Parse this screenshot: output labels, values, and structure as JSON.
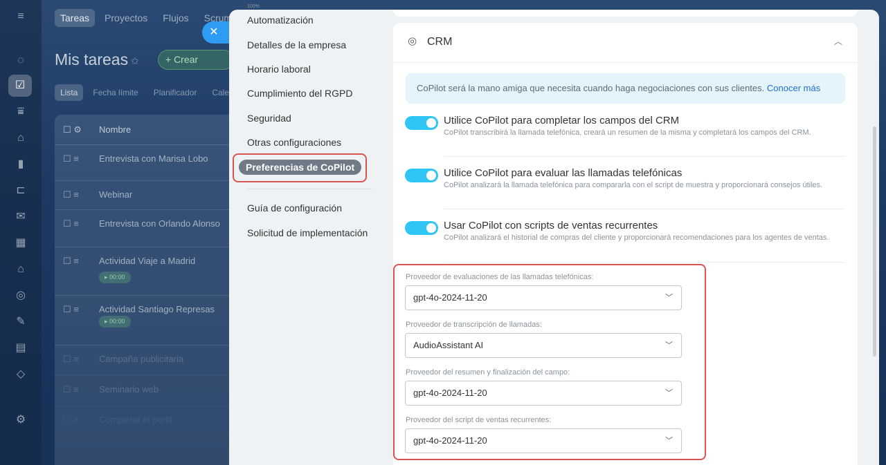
{
  "background_app": {
    "tabs": [
      "Tareas",
      "Proyectos",
      "Flujos",
      "Scrum"
    ],
    "title": "Mis tareas",
    "create_label": "+ Crear",
    "views": [
      "Lista",
      "Fecha límite",
      "Planificador",
      "Calen"
    ],
    "table_header": "Nombre",
    "rows": [
      {
        "name": "Entrevista con Marisa Lobo",
        "timer": ""
      },
      {
        "name": "Webinar",
        "timer": ""
      },
      {
        "name": "Entrevista con Orlando Alonso",
        "timer": ""
      },
      {
        "name": "Actividad Viaje a Madrid",
        "timer": "▸ 00:00"
      },
      {
        "name": "Actividad Santiago Represas",
        "timer": "▸ 00:00"
      },
      {
        "name": "Campaña publicitaria",
        "timer": ""
      },
      {
        "name": "Seminario web",
        "timer": ""
      },
      {
        "name": "Completar el perfil",
        "timer": ""
      }
    ]
  },
  "panel": {
    "zoom": "100%",
    "nav": {
      "items": [
        {
          "label": "Automatización"
        },
        {
          "label": "Detalles de la empresa"
        },
        {
          "label": "Horario laboral"
        },
        {
          "label": "Cumplimiento del RGPD"
        },
        {
          "label": "Seguridad"
        },
        {
          "label": "Otras configuraciones"
        },
        {
          "label": "Preferencias de CoPilot"
        },
        {
          "label": "Guía de configuración"
        },
        {
          "label": "Solicitud de implementación"
        }
      ],
      "active_index": 6
    },
    "crm": {
      "title": "CRM",
      "info_text": "CoPilot será la mano amiga que necesita cuando haga negociaciones con sus clientes.",
      "info_link": "Conocer más",
      "options": [
        {
          "title": "Utilice CoPilot para completar los campos del CRM",
          "description": "CoPilot transcribirá la llamada telefónica, creará un resumen de la misma y completará los campos del CRM.",
          "enabled": true
        },
        {
          "title": "Utilice CoPilot para evaluar las llamadas telefónicas",
          "description": "CoPilot analizará la llamada telefónica para compararla con el script de muestra y proporcionará consejos útiles.",
          "enabled": true
        },
        {
          "title": "Usar CoPilot con scripts de ventas recurrentes",
          "description": "CoPilot analizará el historial de compras del cliente y proporcionará recomendaciones para los agentes de ventas.",
          "enabled": true
        }
      ],
      "providers": [
        {
          "label": "Proveedor de evaluaciones de las llamadas telefónicas:",
          "value": "gpt-4o-2024-11-20"
        },
        {
          "label": "Proveedor de transcripción de llamadas:",
          "value": "AudioAssistant AI"
        },
        {
          "label": "Proveedor del resumen y finalización del campo:",
          "value": "gpt-4o-2024-11-20"
        },
        {
          "label": "Proveedor del script de ventas recurrentes:",
          "value": "gpt-4o-2024-11-20"
        }
      ]
    }
  },
  "icons": {
    "close": "close-icon",
    "crm": "crm-icon",
    "collapse": "chevron-up-icon",
    "select": "chevron-down-icon"
  },
  "colors": {
    "accent": "#2fc6f6",
    "highlight": "#d9534f",
    "link": "#1f6fd1"
  }
}
